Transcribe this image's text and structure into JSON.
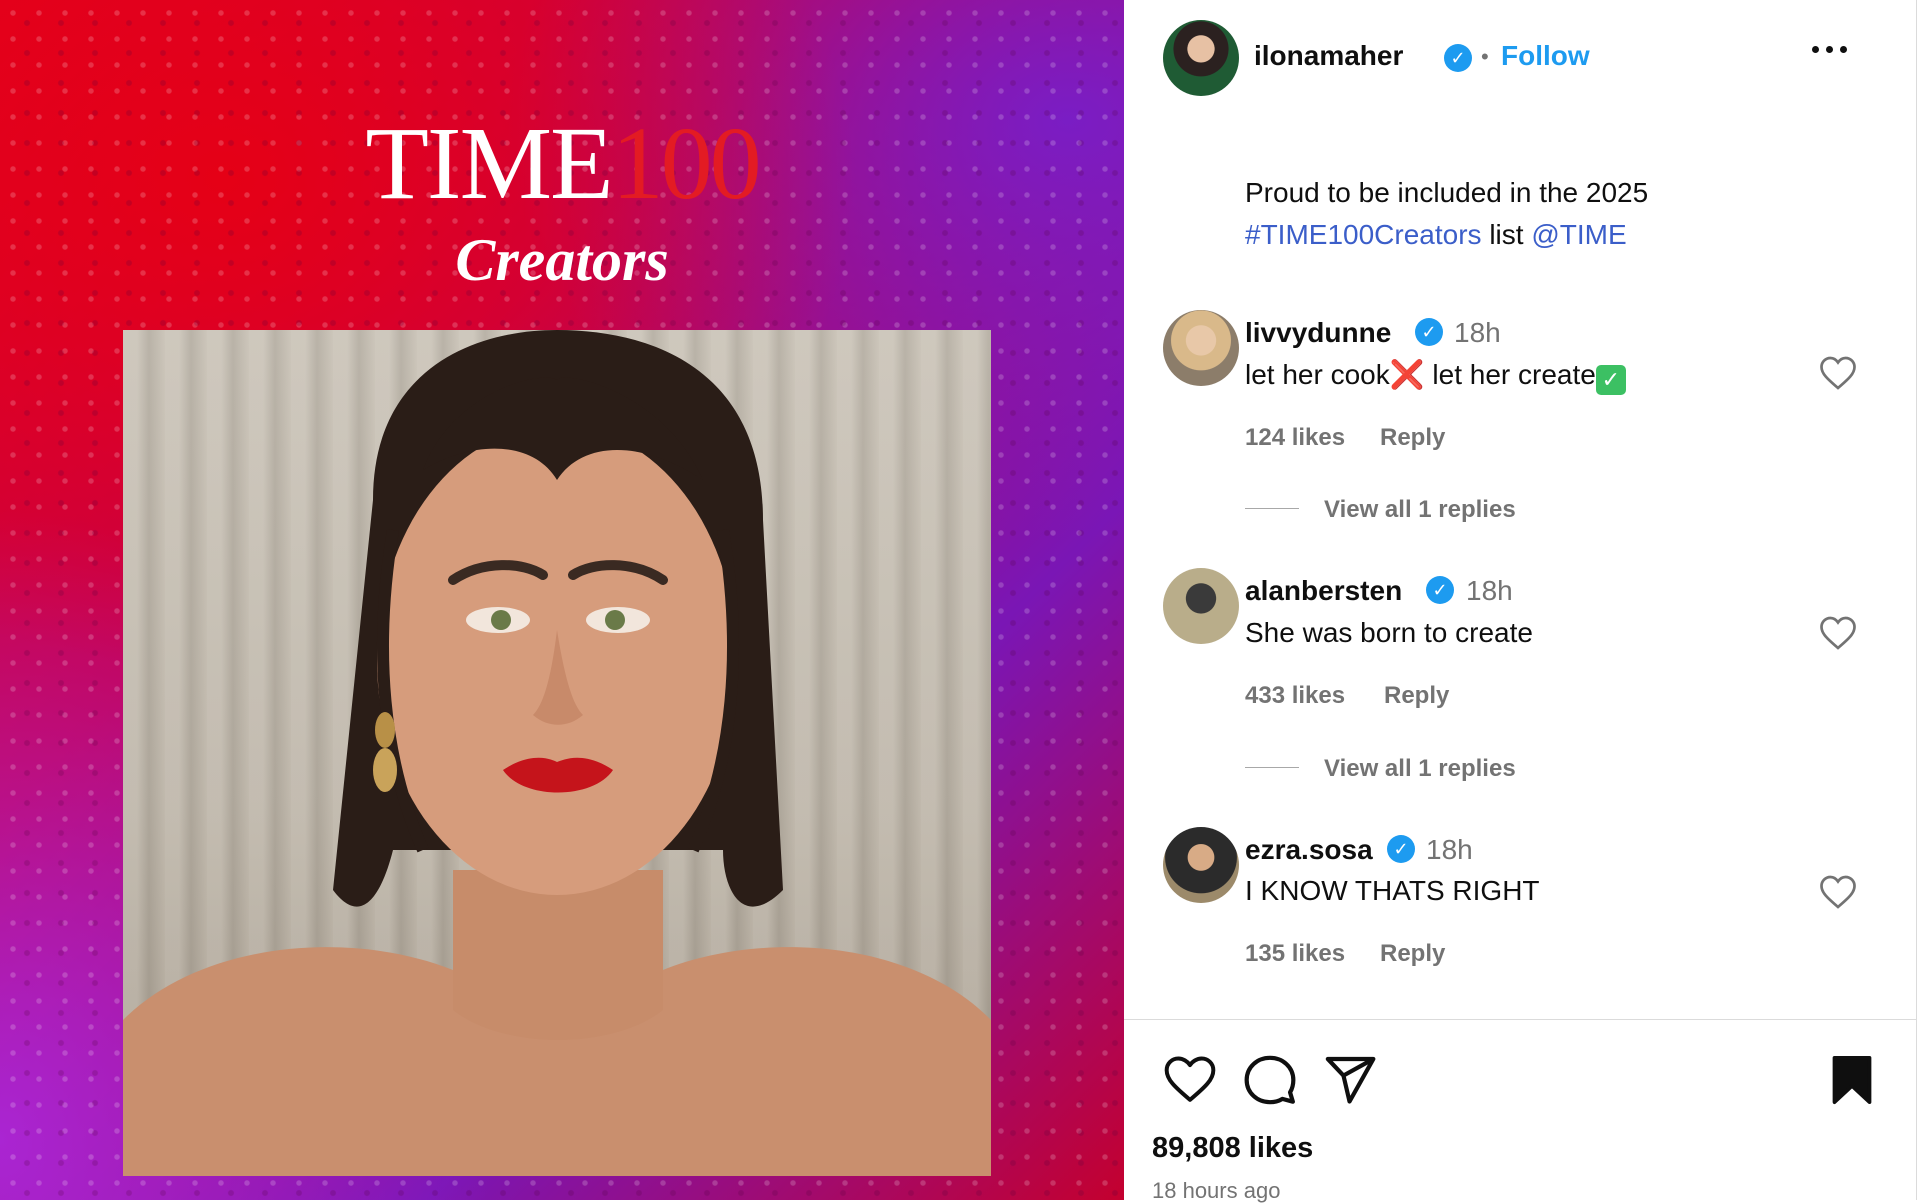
{
  "post": {
    "image": {
      "logo_word": "TIME",
      "logo_number": "100",
      "logo_sub": "Creators"
    },
    "header": {
      "username": "ilonamaher",
      "verified_icon": "verified-badge-icon",
      "separator": "•",
      "follow_label": "Follow",
      "more_icon": "more-options-icon"
    },
    "caption": {
      "text_line1": "Proud to be included in the 2025",
      "hashtag": "#TIME100Creators",
      "middle": " list ",
      "mention": "@TIME"
    },
    "comments": [
      {
        "username": "livvydunne",
        "time": "18h",
        "text_a": "let her cook",
        "emoji_x": "❌",
        "text_b": " let her create",
        "emoji_check": "✓",
        "likes": "124 likes",
        "reply_label": "Reply",
        "view_replies": "View all 1 replies"
      },
      {
        "username": "alanbersten",
        "time": "18h",
        "text": "She was born to create",
        "likes": "433 likes",
        "reply_label": "Reply",
        "view_replies": "View all 1 replies"
      },
      {
        "username": "ezra.sosa",
        "time": "18h",
        "text": "I KNOW THATS RIGHT",
        "likes": "135 likes",
        "reply_label": "Reply"
      }
    ],
    "actions": {
      "like_icon": "heart-icon",
      "comment_icon": "comment-icon",
      "share_icon": "share-icon",
      "save_icon": "bookmark-icon"
    },
    "likes_total": "89,808 likes",
    "posted_time": "18 hours ago"
  },
  "colors": {
    "accent_blue": "#1d9bf0",
    "link_blue": "#3b5ec9",
    "muted_gray": "#737373",
    "time_red": "#e31b23"
  }
}
